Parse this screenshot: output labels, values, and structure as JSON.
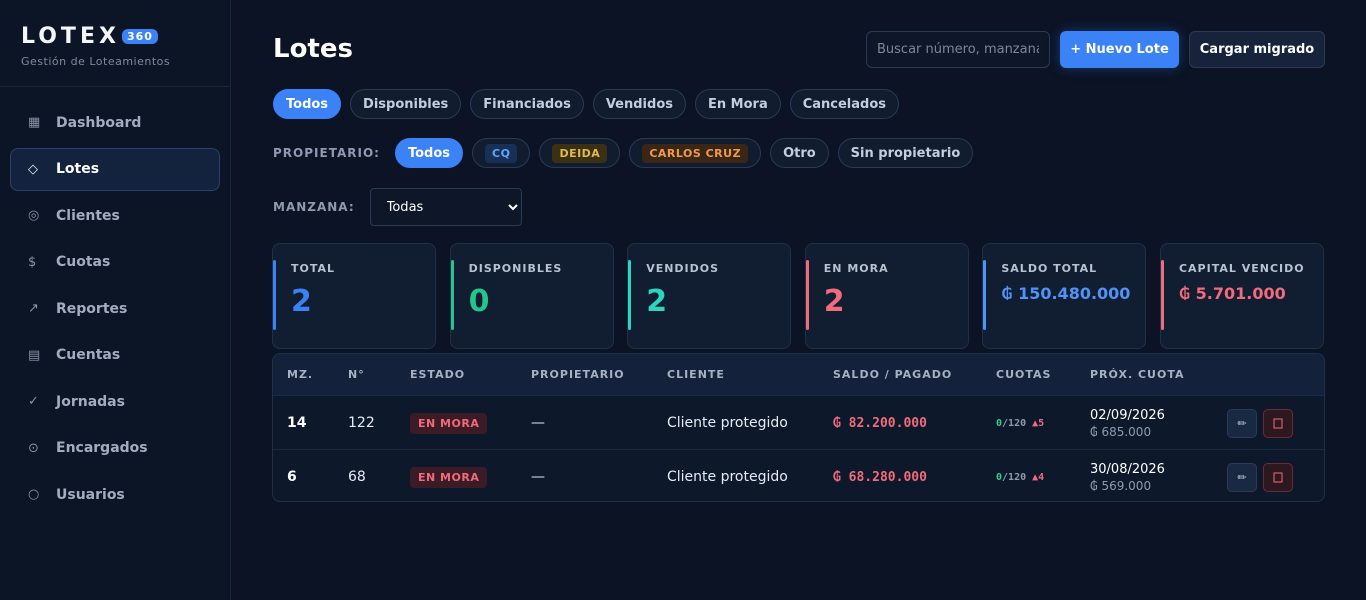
{
  "brand": {
    "name": "LOTEX",
    "badge": "360",
    "subtitle": "Gestión de Loteamientos"
  },
  "sidebar": {
    "items": [
      {
        "label": "Dashboard",
        "icon": "▦",
        "active": false
      },
      {
        "label": "Lotes",
        "icon": "◇",
        "active": true
      },
      {
        "label": "Clientes",
        "icon": "◎",
        "active": false
      },
      {
        "label": "Cuotas",
        "icon": "$",
        "active": false
      },
      {
        "label": "Reportes",
        "icon": "↗",
        "active": false
      },
      {
        "label": "Cuentas",
        "icon": "▤",
        "active": false
      },
      {
        "label": "Jornadas",
        "icon": "✓",
        "active": false
      },
      {
        "label": "Encargados",
        "icon": "⊙",
        "active": false
      },
      {
        "label": "Usuarios",
        "icon": "○",
        "active": false
      }
    ]
  },
  "header": {
    "title": "Lotes",
    "search_placeholder": "Buscar número, manzana, cliente...",
    "new_button": "+ Nuevo Lote",
    "load_button": "Cargar migrado"
  },
  "status_filters": [
    "Todos",
    "Disponibles",
    "Financiados",
    "Vendidos",
    "En Mora",
    "Cancelados"
  ],
  "owner_filter": {
    "label": "PROPIETARIO:",
    "all": "Todos",
    "cq": "CQ",
    "deida": "DEIDA",
    "carlos": "CARLOS CRUZ",
    "other": "Otro",
    "none": "Sin propietario"
  },
  "block_filter": {
    "label": "MANZANA:",
    "selected": "Todas"
  },
  "stats": {
    "total": {
      "label": "TOTAL",
      "value": "2",
      "color": "#3b82f6"
    },
    "disponibles": {
      "label": "DISPONIBLES",
      "value": "0",
      "color": "#22c58b"
    },
    "vendidos": {
      "label": "VENDIDOS",
      "value": "2",
      "color": "#2dd4bf"
    },
    "en_mora": {
      "label": "EN MORA",
      "value": "2",
      "color": "#f06b7b"
    },
    "saldo_total": {
      "label": "SALDO TOTAL",
      "value": "₲ 150.480.000",
      "color": "#4f93f7"
    },
    "capital_vencido": {
      "label": "CAPITAL VENCIDO",
      "value": "₲ 5.701.000",
      "color": "#f06b7b"
    }
  },
  "table": {
    "headers": {
      "mz": "MZ.",
      "num": "N°",
      "estado": "ESTADO",
      "propietario": "PROPIETARIO",
      "cliente": "CLIENTE",
      "saldo": "SALDO / PAGADO",
      "cuotas": "CUOTAS",
      "prox": "PRÓX. CUOTA"
    },
    "rows": [
      {
        "mz": "14",
        "num": "122",
        "estado": "EN MORA",
        "propietario": "—",
        "cliente": "Cliente protegido",
        "saldo": "₲ 82.200.000",
        "cuotas_paid": "0",
        "cuotas_total": "/120",
        "cuotas_alert": "▲5",
        "prox_date": "02/09/2026",
        "prox_amount": "₲ 685.000"
      },
      {
        "mz": "6",
        "num": "68",
        "estado": "EN MORA",
        "propietario": "—",
        "cliente": "Cliente protegido",
        "saldo": "₲ 68.280.000",
        "cuotas_paid": "0",
        "cuotas_total": "/120",
        "cuotas_alert": "▲4",
        "prox_date": "30/08/2026",
        "prox_amount": "₲ 569.000"
      }
    ],
    "edit_icon": "✏",
    "delete_icon": "🗑"
  }
}
